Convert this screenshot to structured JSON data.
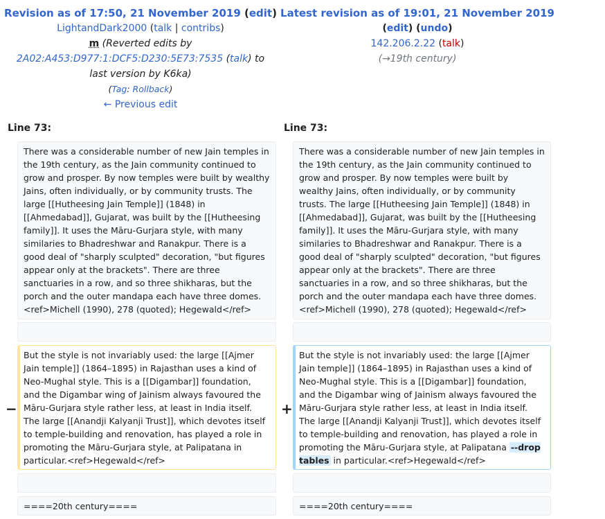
{
  "left": {
    "title_prefix": "Revision as of 17:50, 21 November 2019",
    "edit_label": "edit",
    "user": "LightandDark2000",
    "talk_label": "talk",
    "contribs_label": "contribs",
    "minor_flag": "m",
    "summary_1": "(Reverted edits by",
    "ip_user": "2A02:A453:D977:1:DCF5:D230:5E73:7535",
    "summary_talk": "talk",
    "summary_2": "to",
    "summary_3": "last version by K6ka)",
    "tag_prefix": "(",
    "tag_label": "Tag",
    "tag_value": "Rollback",
    "tag_suffix": ")",
    "prev_edit": "← Previous edit",
    "line_label": "Line 73:"
  },
  "right": {
    "title": "Latest revision as of 19:01, 21 November 2019",
    "edit_label": "edit",
    "undo_label": "undo",
    "user": "142.206.2.22",
    "talk_label": "talk",
    "section_comment": "(→19th century)",
    "line_label": "Line 73:"
  },
  "diff": {
    "para1": "There was a considerable number of new Jain temples in the 19th century, as the Jain community continued to grow and prosper.  By now temples were built by wealthy Jains, often individually, or by community trusts.  The large [[Hutheesing Jain Temple]] (1848) in [[Ahmedabad]], Gujarat, was built by the [[Hutheesing family]]. It uses the Māru-Gurjara style, with many similaries to Bhadreshwar and Ranakpur.  There is a good deal of \"sharply sculpted\" decoration, \"but figures appear only at the brackets\".  There are three sanctuaries in a row, and so three shikharas, but the porch and the outer mandapa each have three domes.<ref>Michell (1990), 278 (quoted); Hegewald</ref>",
    "para2_left": "But the style is not invariably used: the large [[Ajmer Jain temple]] (1864–1895) in Rajasthan uses a kind of Neo-Mughal style.  This is a [[Digambar]] foundation, and the Digambar wing of Jainism always favoured the Māru-Gurjara style rather less, at least in India itself.  The large [[Anandji Kalyanji Trust]], which devotes itself to temple-building and renovation, has played a role in promoting the Māru-Gurjara style, at Palipatana in particular.<ref>Hegewald</ref>",
    "para2_right_before": "But the style is not invariably used: the large [[Ajmer Jain temple]] (1864–1895) in Rajasthan uses a kind of Neo-Mughal style.  This is a [[Digambar]] foundation, and the Digambar wing of Jainism always favoured the Māru-Gurjara style rather less, at least in India itself.  The large [[Anandji Kalyanji Trust]], which devotes itself to temple-building and renovation, has played a role in promoting the Māru-Gurjara style, at Palipatana",
    "para2_inserted": "--drop tables",
    "para2_right_after": " in particular.<ref>Hegewald</ref>",
    "section_heading": "====20th century====",
    "minus": "−",
    "plus": "+"
  }
}
